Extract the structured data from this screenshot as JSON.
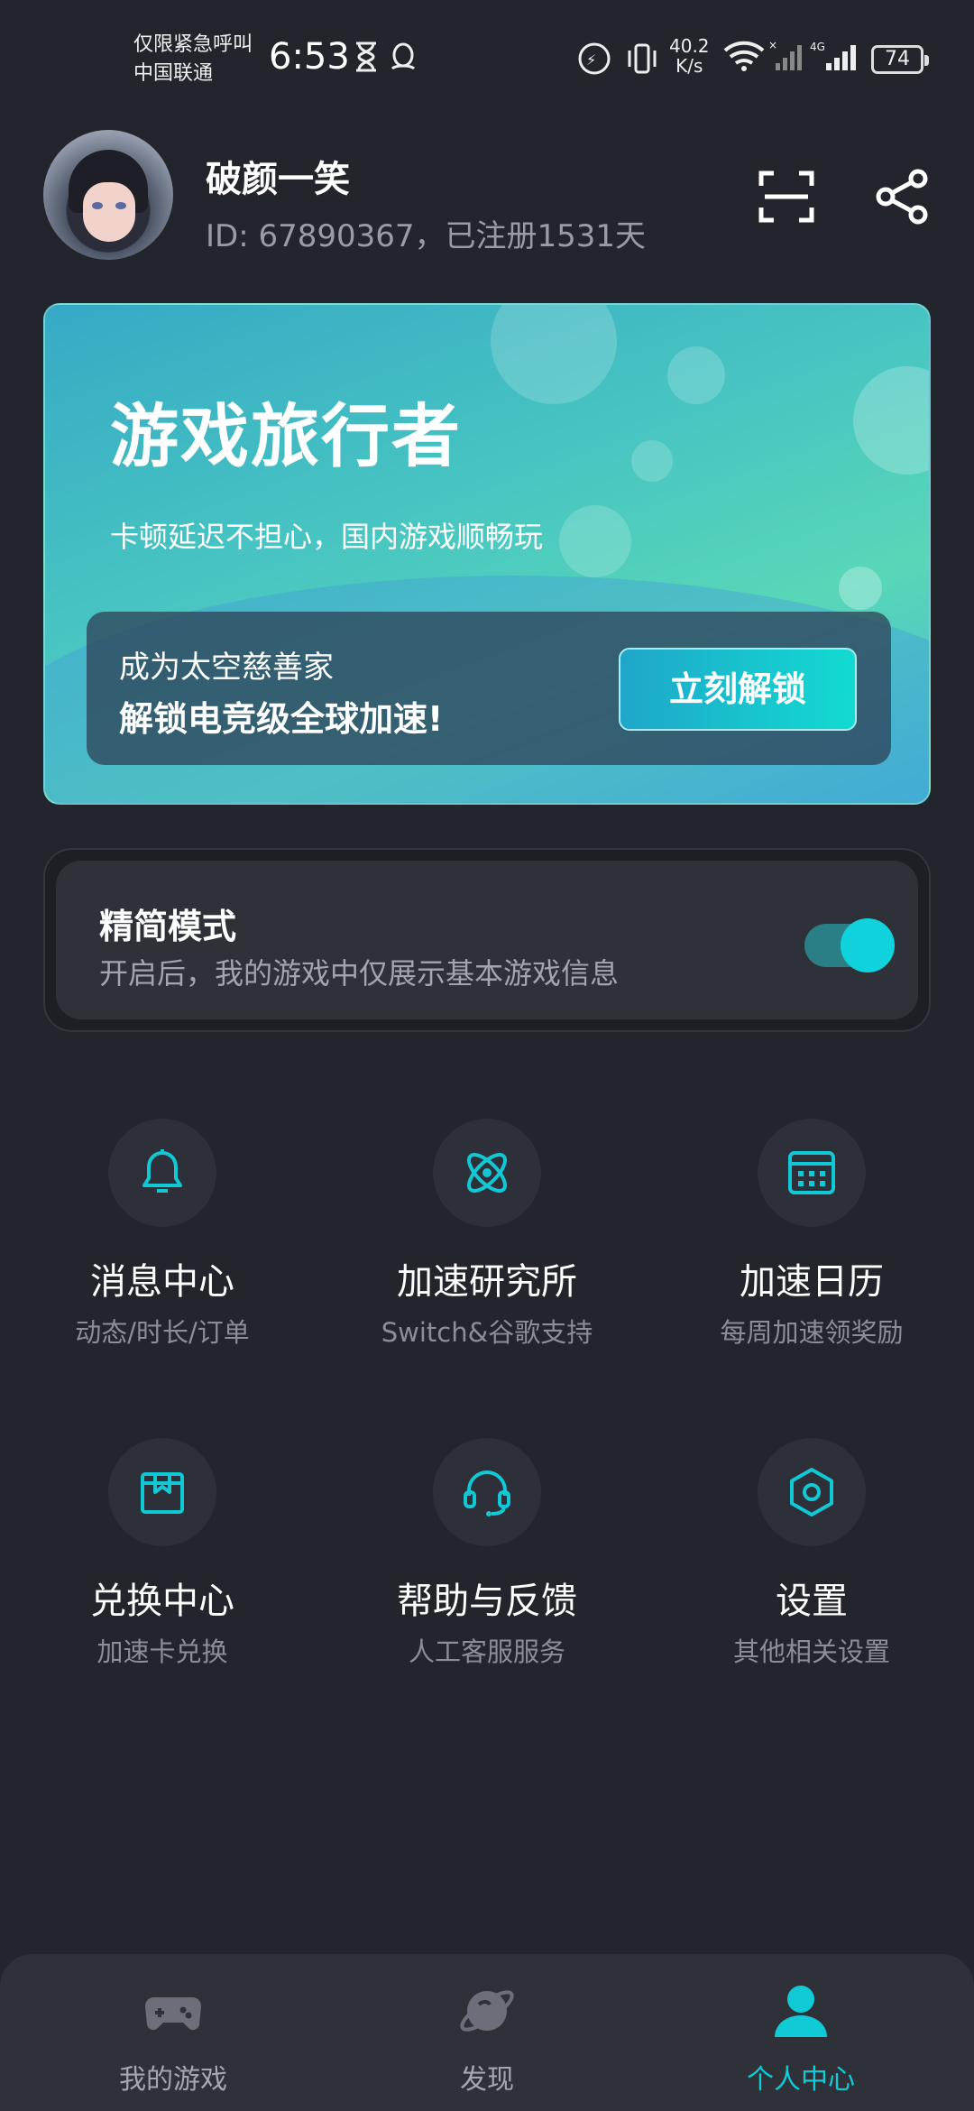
{
  "status_bar": {
    "carrier_line1": "仅限紧急呼叫",
    "carrier_line2": "中国联通",
    "time": "6:53",
    "net_speed_value": "40.2",
    "net_speed_unit": "K/s",
    "network_type": "4G",
    "battery": "74"
  },
  "profile": {
    "username": "破颜一笑",
    "id_text": "ID: 67890367，已注册1531天"
  },
  "banner": {
    "title": "游戏旅行者",
    "subtitle": "卡顿延迟不担心，国内游戏顺畅玩",
    "box_line1": "成为太空慈善家",
    "box_line2": "解锁电竞级全球加速!",
    "button_label": "立刻解锁"
  },
  "simple_mode": {
    "title": "精简模式",
    "description": "开启后，我的游戏中仅展示基本游戏信息",
    "enabled": true
  },
  "grid": [
    {
      "label": "消息中心",
      "sub": "动态/时长/订单",
      "icon": "bell-icon"
    },
    {
      "label": "加速研究所",
      "sub": "Switch&谷歌支持",
      "icon": "atom-icon"
    },
    {
      "label": "加速日历",
      "sub": "每周加速领奖励",
      "icon": "calendar-icon"
    },
    {
      "label": "兑换中心",
      "sub": "加速卡兑换",
      "icon": "gift-box-icon"
    },
    {
      "label": "帮助与反馈",
      "sub": "人工客服服务",
      "icon": "headset-icon"
    },
    {
      "label": "设置",
      "sub": "其他相关设置",
      "icon": "settings-hex-icon"
    }
  ],
  "bottom_nav": [
    {
      "label": "我的游戏",
      "icon": "gamepad-icon",
      "active": false
    },
    {
      "label": "发现",
      "icon": "planet-icon",
      "active": false
    },
    {
      "label": "个人中心",
      "icon": "person-icon",
      "active": true
    }
  ],
  "colors": {
    "background": "#23252c",
    "accent": "#10cbd6",
    "card": "#2f3139"
  }
}
